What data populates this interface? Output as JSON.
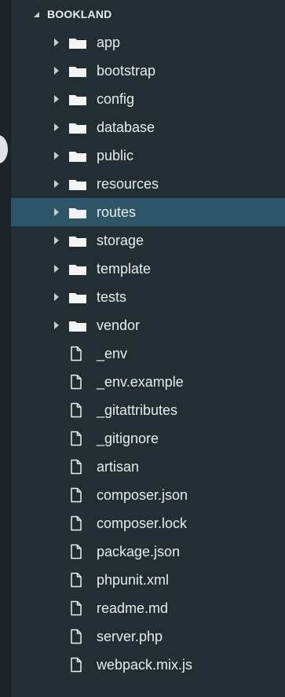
{
  "explorer": {
    "root": {
      "label": "BOOKLAND",
      "expanded": true
    },
    "folders": [
      {
        "label": "app"
      },
      {
        "label": "bootstrap"
      },
      {
        "label": "config"
      },
      {
        "label": "database"
      },
      {
        "label": "public"
      },
      {
        "label": "resources"
      },
      {
        "label": "routes",
        "selected": true
      },
      {
        "label": "storage"
      },
      {
        "label": "template"
      },
      {
        "label": "tests"
      },
      {
        "label": "vendor"
      }
    ],
    "files": [
      {
        "label": "_env"
      },
      {
        "label": "_env.example"
      },
      {
        "label": "_gitattributes"
      },
      {
        "label": "_gitignore"
      },
      {
        "label": "artisan"
      },
      {
        "label": "composer.json"
      },
      {
        "label": "composer.lock"
      },
      {
        "label": "package.json"
      },
      {
        "label": "phpunit.xml"
      },
      {
        "label": "readme.md"
      },
      {
        "label": "server.php"
      },
      {
        "label": "webpack.mix.js"
      }
    ]
  },
  "colors": {
    "background": "#232e34",
    "selection": "#2e5566",
    "text": "#e6ebee"
  },
  "icons": {
    "folder": "folder-icon",
    "file": "file-icon",
    "collapsed": "chevron-right-icon",
    "expanded": "chevron-down-icon"
  }
}
